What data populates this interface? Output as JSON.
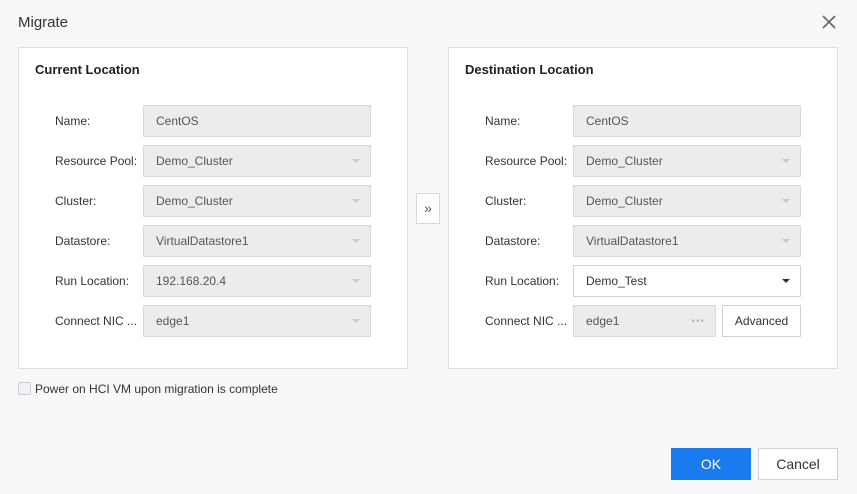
{
  "dialog": {
    "title": "Migrate",
    "close_icon": "close-icon"
  },
  "current": {
    "title": "Current Location",
    "name_label": "Name:",
    "name_value": "CentOS",
    "pool_label": "Resource Pool:",
    "pool_value": "Demo_Cluster",
    "cluster_label": "Cluster:",
    "cluster_value": "Demo_Cluster",
    "datastore_label": "Datastore:",
    "datastore_value": "VirtualDatastore1",
    "run_label": "Run Location:",
    "run_value": "192.168.20.4",
    "nic_label": "Connect NIC ...",
    "nic_value": "edge1"
  },
  "destination": {
    "title": "Destination Location",
    "name_label": "Name:",
    "name_value": "CentOS",
    "pool_label": "Resource Pool:",
    "pool_value": "Demo_Cluster",
    "cluster_label": "Cluster:",
    "cluster_value": "Demo_Cluster",
    "datastore_label": "Datastore:",
    "datastore_value": "VirtualDatastore1",
    "run_label": "Run Location:",
    "run_value": "Demo_Test",
    "nic_label": "Connect NIC ...",
    "nic_value": "edge1",
    "advanced_label": "Advanced"
  },
  "move_button_glyph": "»",
  "power_on_label": "Power on HCI VM upon migration is complete",
  "power_on_checked": false,
  "footer": {
    "ok_label": "OK",
    "cancel_label": "Cancel"
  },
  "colors": {
    "primary": "#1a7bf0",
    "background": "#f7f8fa",
    "disabled_field": "#ececec"
  }
}
